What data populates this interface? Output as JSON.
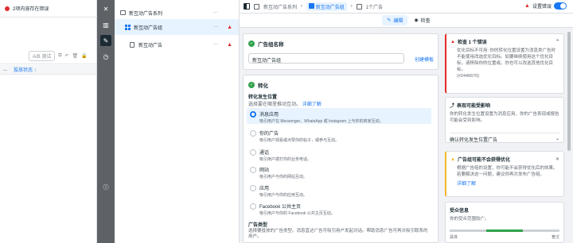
{
  "left_panel": {
    "error_text": "2项内容存在错误",
    "ab_test": "A/B 测试",
    "tab1": "...",
    "tab2": "投放状态 ↑"
  },
  "tree": {
    "items": [
      {
        "label": "新互动广告系列",
        "more": "···"
      },
      {
        "label": "新互动广告组",
        "more": "···",
        "warn": "▲"
      },
      {
        "label": "新互动广告",
        "more": "···",
        "warn": "▲"
      }
    ]
  },
  "topbar": {
    "crumbs": [
      "新互动广告系列",
      "新互动广告组",
      "1个广告"
    ],
    "settings_error": "设置错误"
  },
  "editbar": {
    "edit": "编辑",
    "review": "检查"
  },
  "adset_name": {
    "title": "广告组名称",
    "value": "新互动广告组",
    "create_template": "创建模板"
  },
  "conversion": {
    "title": "转化",
    "location_title": "转化发生位置",
    "location_desc": "选择要在哪里推动互动。",
    "learn_more": "详细了解",
    "options": [
      {
        "title": "消息应用",
        "desc": "吸引用户在 Messenger、WhatsApp 或 Instagram 上与你的商家互动。"
      },
      {
        "title": "你的广告",
        "desc": "吸引用户观看或点赞你的帖子，或参与互动。"
      },
      {
        "title": "通话",
        "desc": "吸引用户拨打你的业务电话。"
      },
      {
        "title": "网站",
        "desc": "吸引用户与你的网站互动。"
      },
      {
        "title": "应用",
        "desc": "吸引用户与你的应用互动。"
      },
      {
        "title": "Facebook 公共主页",
        "desc": "吸引用户与你的 Facebook 公共主页互动。"
      }
    ],
    "ad_type_title": "广告类型",
    "ad_type_desc": "选择要投放的广告类型。消息直达广告可吸引用户发起对话。帮助消息广告可再次吸引联系的用户。"
  },
  "right": {
    "errors": {
      "title": "检查 1 个错误",
      "body": "优化目标不可用: 你的转化位置设置为消息类广告时不能使用改选优化目标。如要继续使用这个优化目标，请移除你的位置或。你也可以改选其他优化目标。",
      "code": "(#2446670)"
    },
    "perf": {
      "title": "表现可能受影响",
      "body": "你的转化发生位置设置为消息应用，你的广告表现或报告可能会受到影响。",
      "row": "确认转化发生位置广告"
    },
    "warn": {
      "title": "广告组可能不会获得优化",
      "body": "根据广告组的设置，你可能不会获得优化后的效果。若要解决这一问题，建议你再次发布广告组。",
      "link": "详细了解"
    },
    "reach": {
      "title": "受众信息",
      "desc": "你的受众范围较广。",
      "low": "具体",
      "high": "宽泛"
    }
  }
}
